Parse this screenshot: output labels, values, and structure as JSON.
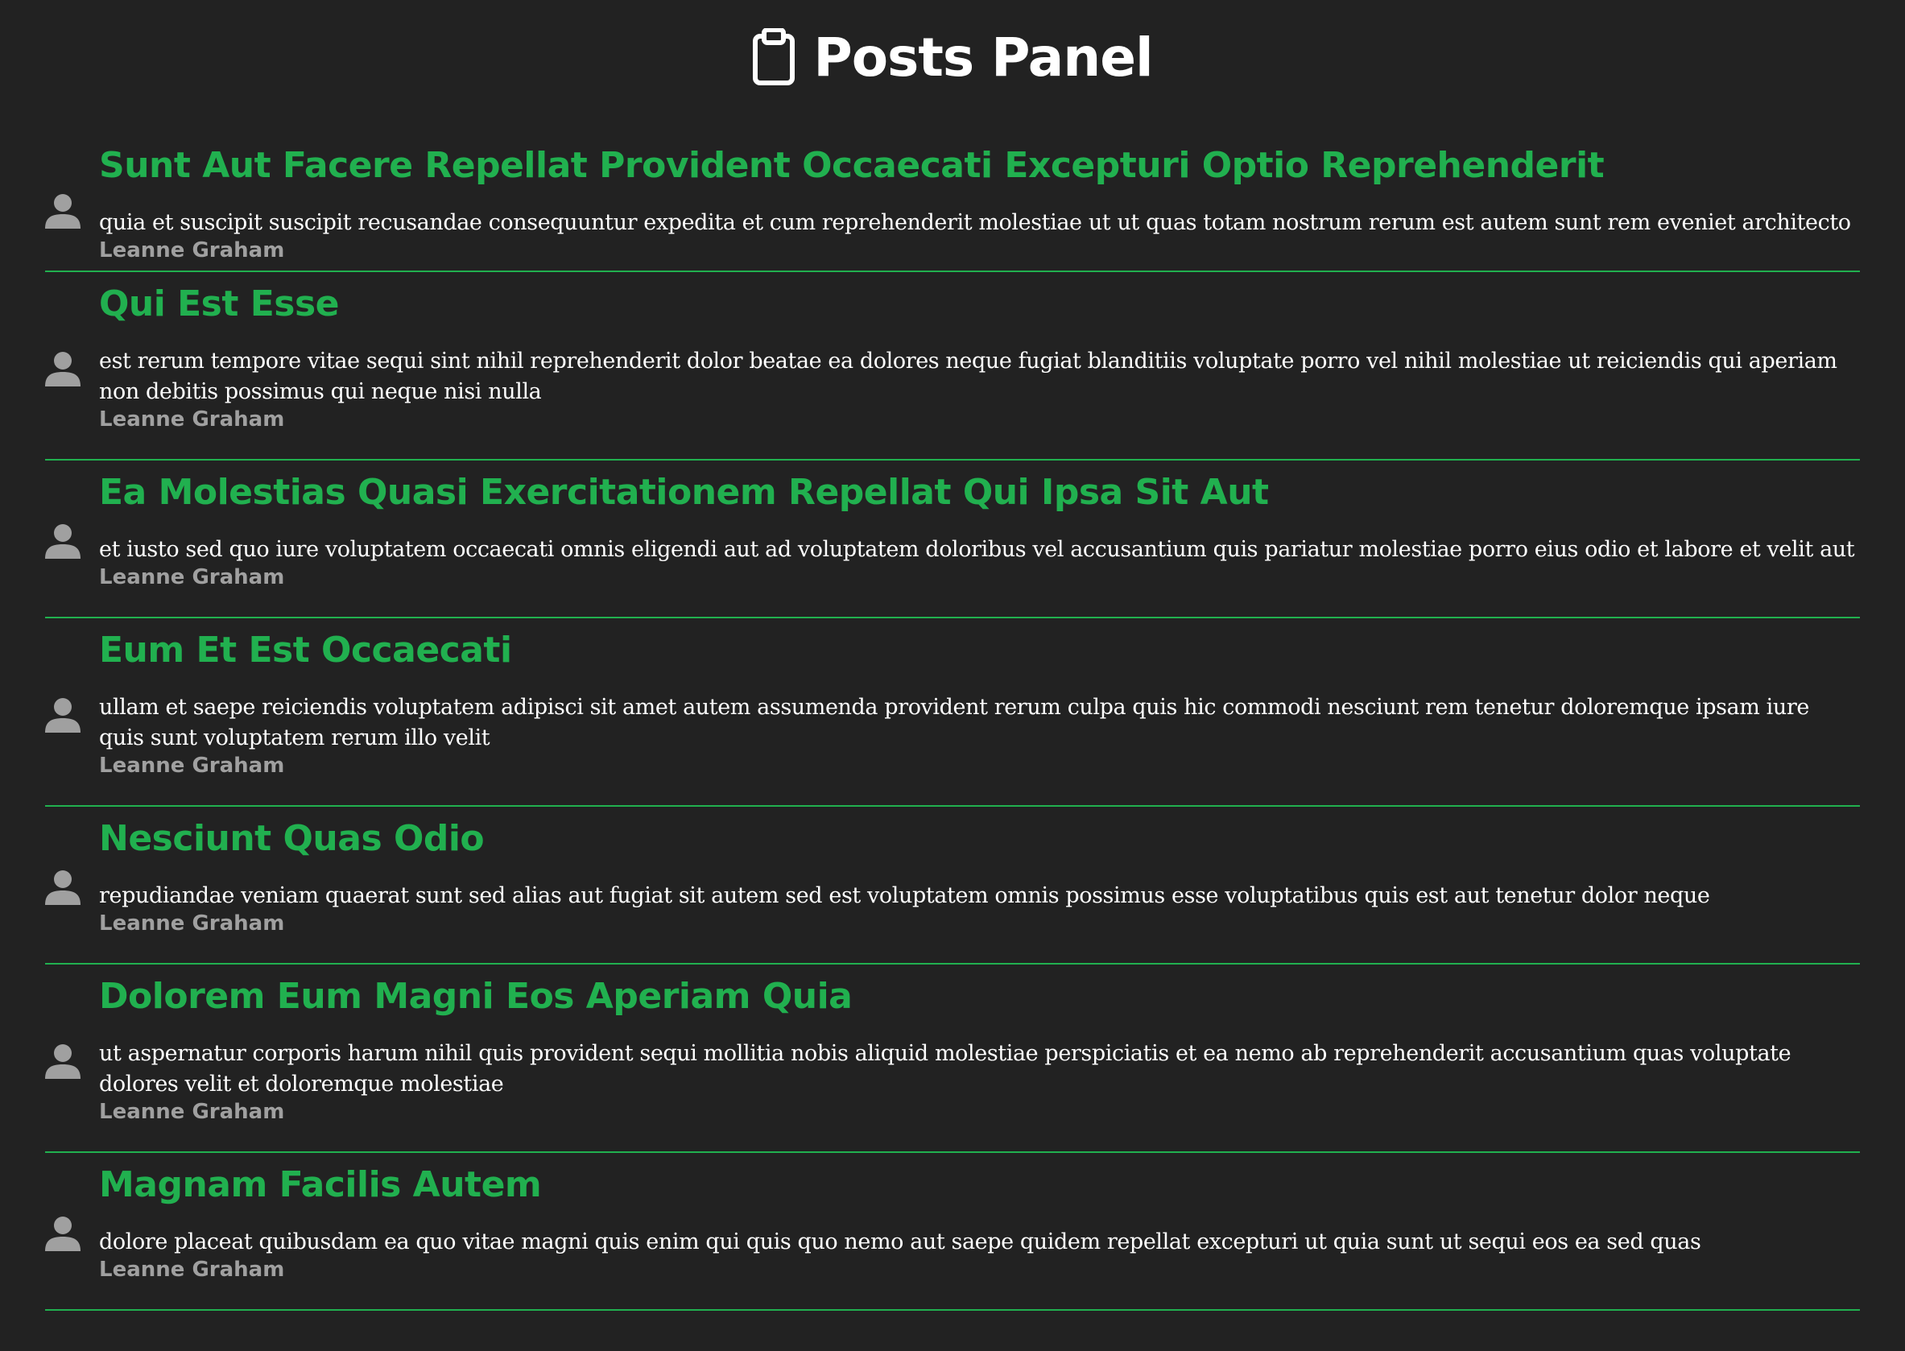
{
  "header": {
    "title": "Posts Panel",
    "icon": "clipboard-icon"
  },
  "colors": {
    "background": "#222222",
    "accent": "#21b04f",
    "author": "#a0a0a0",
    "text": "#ffffff"
  },
  "posts": [
    {
      "title": "Sunt Aut Facere Repellat Provident Occaecati Excepturi Optio Reprehenderit",
      "body": "quia et suscipit suscipit recusandae consequuntur expedita et cum reprehenderit molestiae ut ut quas totam nostrum rerum est autem sunt rem eveniet architecto",
      "author": "Leanne Graham",
      "icon": "user-icon"
    },
    {
      "title": "Qui Est Esse",
      "body": "est rerum tempore vitae sequi sint nihil reprehenderit dolor beatae ea dolores neque fugiat blanditiis voluptate porro vel nihil molestiae ut reiciendis qui aperiam non debitis possimus qui neque nisi nulla",
      "author": "Leanne Graham",
      "icon": "user-icon"
    },
    {
      "title": "Ea Molestias Quasi Exercitationem Repellat Qui Ipsa Sit Aut",
      "body": "et iusto sed quo iure voluptatem occaecati omnis eligendi aut ad voluptatem doloribus vel accusantium quis pariatur molestiae porro eius odio et labore et velit aut",
      "author": "Leanne Graham",
      "icon": "user-icon"
    },
    {
      "title": "Eum Et Est Occaecati",
      "body": "ullam et saepe reiciendis voluptatem adipisci sit amet autem assumenda provident rerum culpa quis hic commodi nesciunt rem tenetur doloremque ipsam iure quis sunt voluptatem rerum illo velit",
      "author": "Leanne Graham",
      "icon": "user-icon"
    },
    {
      "title": "Nesciunt Quas Odio",
      "body": "repudiandae veniam quaerat sunt sed alias aut fugiat sit autem sed est voluptatem omnis possimus esse voluptatibus quis est aut tenetur dolor neque",
      "author": "Leanne Graham",
      "icon": "user-icon"
    },
    {
      "title": "Dolorem Eum Magni Eos Aperiam Quia",
      "body": "ut aspernatur corporis harum nihil quis provident sequi mollitia nobis aliquid molestiae perspiciatis et ea nemo ab reprehenderit accusantium quas voluptate dolores velit et doloremque molestiae",
      "author": "Leanne Graham",
      "icon": "user-icon"
    },
    {
      "title": "Magnam Facilis Autem",
      "body": "dolore placeat quibusdam ea quo vitae magni quis enim qui quis quo nemo aut saepe quidem repellat excepturi ut quia sunt ut sequi eos ea sed quas",
      "author": "Leanne Graham",
      "icon": "user-icon"
    }
  ]
}
